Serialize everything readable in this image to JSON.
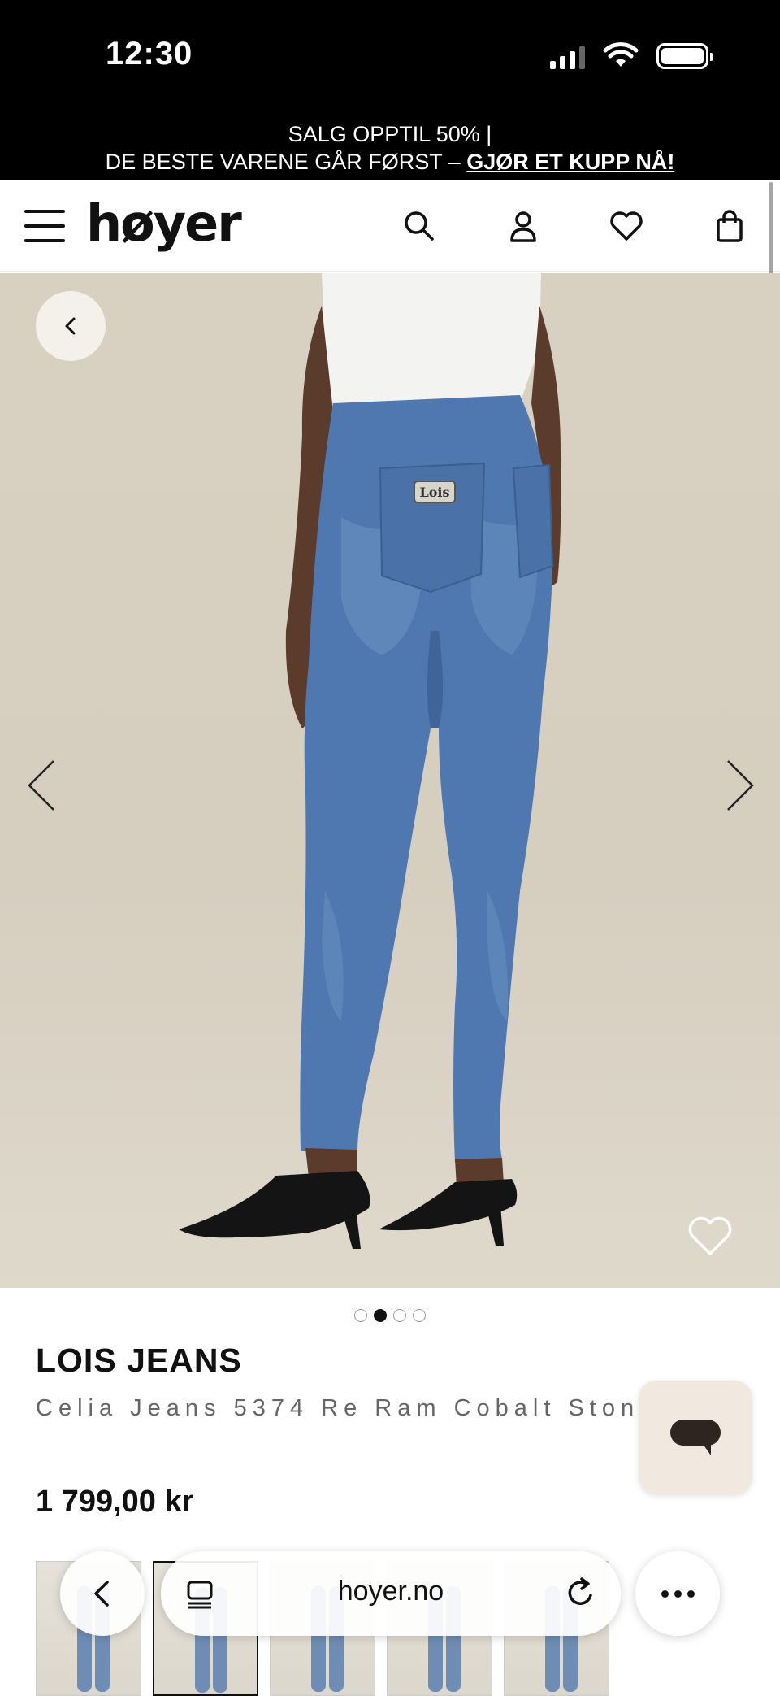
{
  "status_bar": {
    "time": "12:30"
  },
  "promo": {
    "line1": "SALG OPPTIL 50%  |",
    "line2": "DE BESTE VARENE GÅR FØRST – ",
    "cta": "GJØR ET KUPP NÅ!"
  },
  "header": {
    "logo": "høyer",
    "icons": [
      "menu-icon",
      "search-icon",
      "user-icon",
      "heart-icon",
      "shopping-bag-icon"
    ]
  },
  "gallery": {
    "image_description": "Rear view of model wearing blue skinny jeans with black slingback heels",
    "pocket_patch": "Lois",
    "slides": 4,
    "active_slide": 2
  },
  "product": {
    "brand": "LOIS JEANS",
    "name": "Celia Jeans 5374 Re Ram Cobalt Stone",
    "price": "1 799,00 kr"
  },
  "browser": {
    "url": "hoyer.no"
  },
  "colors": {
    "black": "#000000",
    "denim": "#4f78b0",
    "background": "#d8d0c0",
    "chat_button": "#f1e9e0"
  }
}
